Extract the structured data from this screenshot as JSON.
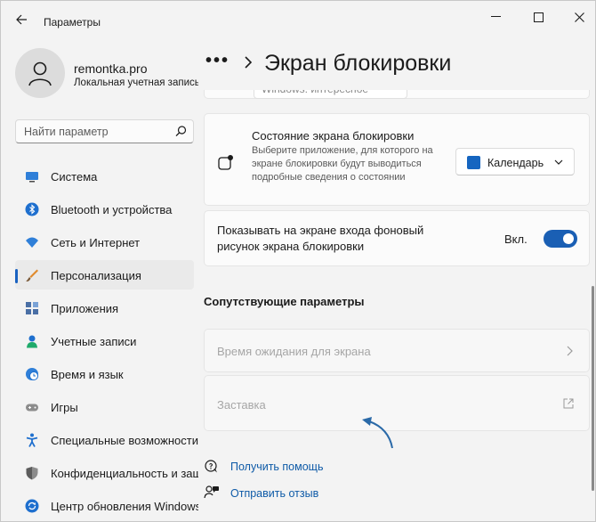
{
  "window": {
    "title": "Параметры"
  },
  "user": {
    "name": "remontka.pro",
    "account_type": "Локальная учетная запись"
  },
  "search": {
    "placeholder": "Найти параметр"
  },
  "nav": {
    "items": [
      {
        "label": "Система",
        "icon": "monitor-icon",
        "color": "#2f7fd8"
      },
      {
        "label": "Bluetooth и устройства",
        "icon": "bluetooth-icon",
        "color": "#1e6fce"
      },
      {
        "label": "Сеть и Интернет",
        "icon": "wifi-icon",
        "color": "#2f7fd8"
      },
      {
        "label": "Персонализация",
        "icon": "brush-icon",
        "color": "#e08a2c"
      },
      {
        "label": "Приложения",
        "icon": "apps-icon",
        "color": "#4a6fa5"
      },
      {
        "label": "Учетные записи",
        "icon": "person-icon",
        "color": "#1faa6b"
      },
      {
        "label": "Время и язык",
        "icon": "clock-globe-icon",
        "color": "#2f7fd8"
      },
      {
        "label": "Игры",
        "icon": "gamepad-icon",
        "color": "#7d7d7d"
      },
      {
        "label": "Специальные возможности",
        "icon": "accessibility-icon",
        "color": "#1e6fce"
      },
      {
        "label": "Конфиденциальность и защита",
        "icon": "shield-icon",
        "color": "#7d7d7d"
      },
      {
        "label": "Центр обновления Windows",
        "icon": "update-icon",
        "color": "#1e6fce"
      }
    ],
    "active_index": 3
  },
  "header": {
    "breadcrumb_dots": "•••",
    "title": "Экран блокировки"
  },
  "content": {
    "peek_dropdown": "Windows: интересное",
    "lock_status": {
      "title": "Состояние экрана блокировки",
      "description": "Выберите приложение, для которого на экране блокировки будут выводиться подробные сведения о состоянии",
      "selected_app": "Календарь"
    },
    "background_toggle": {
      "label_line1": "Показывать на экране входа фоновый",
      "label_line2": "рисунок экрана блокировки",
      "state_label": "Вкл.",
      "on": true
    },
    "related_header": "Сопутствующие параметры",
    "related": [
      {
        "label": "Время ожидания для экрана",
        "kind": "chevron-right-icon"
      },
      {
        "label": "Заставка",
        "kind": "external-link-icon"
      }
    ],
    "help_links": [
      {
        "label": "Получить помощь",
        "icon": "help-chat-icon"
      },
      {
        "label": "Отправить отзыв",
        "icon": "feedback-icon"
      }
    ]
  },
  "colors": {
    "accent": "#1a5fb4",
    "link": "#0e5aa7",
    "arrow": "#2b6aa8"
  }
}
